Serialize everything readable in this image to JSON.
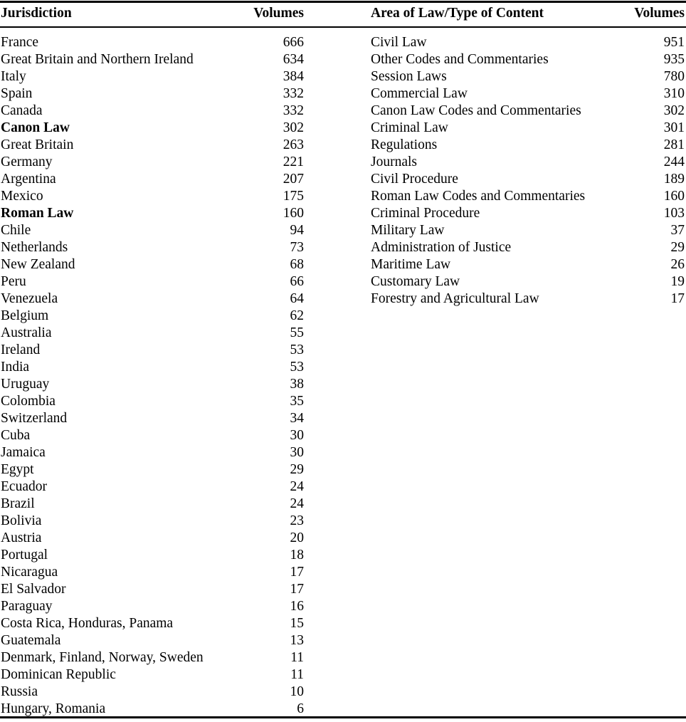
{
  "table_left": {
    "headers": {
      "label": "Jurisdiction",
      "value": "Volumes"
    },
    "rows": [
      {
        "label": "France",
        "value": "666",
        "bold": false
      },
      {
        "label": "Great Britain and Northern Ireland",
        "value": "634",
        "bold": false
      },
      {
        "label": "Italy",
        "value": "384",
        "bold": false
      },
      {
        "label": "Spain",
        "value": "332",
        "bold": false
      },
      {
        "label": "Canada",
        "value": "332",
        "bold": false
      },
      {
        "label": "Canon Law",
        "value": "302",
        "bold": true
      },
      {
        "label": "Great Britain",
        "value": "263",
        "bold": false
      },
      {
        "label": "Germany",
        "value": "221",
        "bold": false
      },
      {
        "label": "Argentina",
        "value": "207",
        "bold": false
      },
      {
        "label": "Mexico",
        "value": "175",
        "bold": false
      },
      {
        "label": "Roman Law",
        "value": "160",
        "bold": true
      },
      {
        "label": "Chile",
        "value": "94",
        "bold": false
      },
      {
        "label": "Netherlands",
        "value": "73",
        "bold": false
      },
      {
        "label": "New Zealand",
        "value": "68",
        "bold": false
      },
      {
        "label": "Peru",
        "value": "66",
        "bold": false
      },
      {
        "label": "Venezuela",
        "value": "64",
        "bold": false
      },
      {
        "label": "Belgium",
        "value": "62",
        "bold": false
      },
      {
        "label": "Australia",
        "value": "55",
        "bold": false
      },
      {
        "label": "Ireland",
        "value": "53",
        "bold": false
      },
      {
        "label": "India",
        "value": "53",
        "bold": false
      },
      {
        "label": "Uruguay",
        "value": "38",
        "bold": false
      },
      {
        "label": "Colombia",
        "value": "35",
        "bold": false
      },
      {
        "label": "Switzerland",
        "value": "34",
        "bold": false
      },
      {
        "label": "Cuba",
        "value": "30",
        "bold": false
      },
      {
        "label": "Jamaica",
        "value": "30",
        "bold": false
      },
      {
        "label": "Egypt",
        "value": "29",
        "bold": false
      },
      {
        "label": "Ecuador",
        "value": "24",
        "bold": false
      },
      {
        "label": "Brazil",
        "value": "24",
        "bold": false
      },
      {
        "label": "Bolivia",
        "value": "23",
        "bold": false
      },
      {
        "label": "Austria",
        "value": "20",
        "bold": false
      },
      {
        "label": "Portugal",
        "value": "18",
        "bold": false
      },
      {
        "label": "Nicaragua",
        "value": "17",
        "bold": false
      },
      {
        "label": "El Salvador",
        "value": "17",
        "bold": false
      },
      {
        "label": "Paraguay",
        "value": "16",
        "bold": false
      },
      {
        "label": "Costa Rica, Honduras, Panama",
        "value": "15",
        "bold": false
      },
      {
        "label": "Guatemala",
        "value": "13",
        "bold": false
      },
      {
        "label": "Denmark, Finland, Norway, Sweden",
        "value": "11",
        "bold": false
      },
      {
        "label": "Dominican Republic",
        "value": "11",
        "bold": false
      },
      {
        "label": "Russia",
        "value": "10",
        "bold": false
      },
      {
        "label": "Hungary, Romania",
        "value": "6",
        "bold": false
      }
    ]
  },
  "table_right": {
    "headers": {
      "label": "Area of Law/Type of Content",
      "value": "Volumes"
    },
    "rows": [
      {
        "label": "Civil Law",
        "value": "951",
        "bold": false
      },
      {
        "label": "Other Codes and Commentaries",
        "value": "935",
        "bold": false
      },
      {
        "label": "Session Laws",
        "value": "780",
        "bold": false
      },
      {
        "label": "Commercial Law",
        "value": "310",
        "bold": false
      },
      {
        "label": "Canon Law Codes and Commentaries",
        "value": "302",
        "bold": false
      },
      {
        "label": "Criminal Law",
        "value": "301",
        "bold": false
      },
      {
        "label": "Regulations",
        "value": "281",
        "bold": false
      },
      {
        "label": "Journals",
        "value": "244",
        "bold": false
      },
      {
        "label": "Civil Procedure",
        "value": "189",
        "bold": false
      },
      {
        "label": "Roman Law Codes and Commentaries",
        "value": "160",
        "bold": false
      },
      {
        "label": "Criminal Procedure",
        "value": "103",
        "bold": false
      },
      {
        "label": "Military Law",
        "value": "37",
        "bold": false
      },
      {
        "label": "Administration of Justice",
        "value": "29",
        "bold": false
      },
      {
        "label": "Maritime Law",
        "value": "26",
        "bold": false
      },
      {
        "label": "Customary Law",
        "value": "19",
        "bold": false
      },
      {
        "label": "Forestry and Agricultural Law",
        "value": "17",
        "bold": false
      }
    ]
  }
}
